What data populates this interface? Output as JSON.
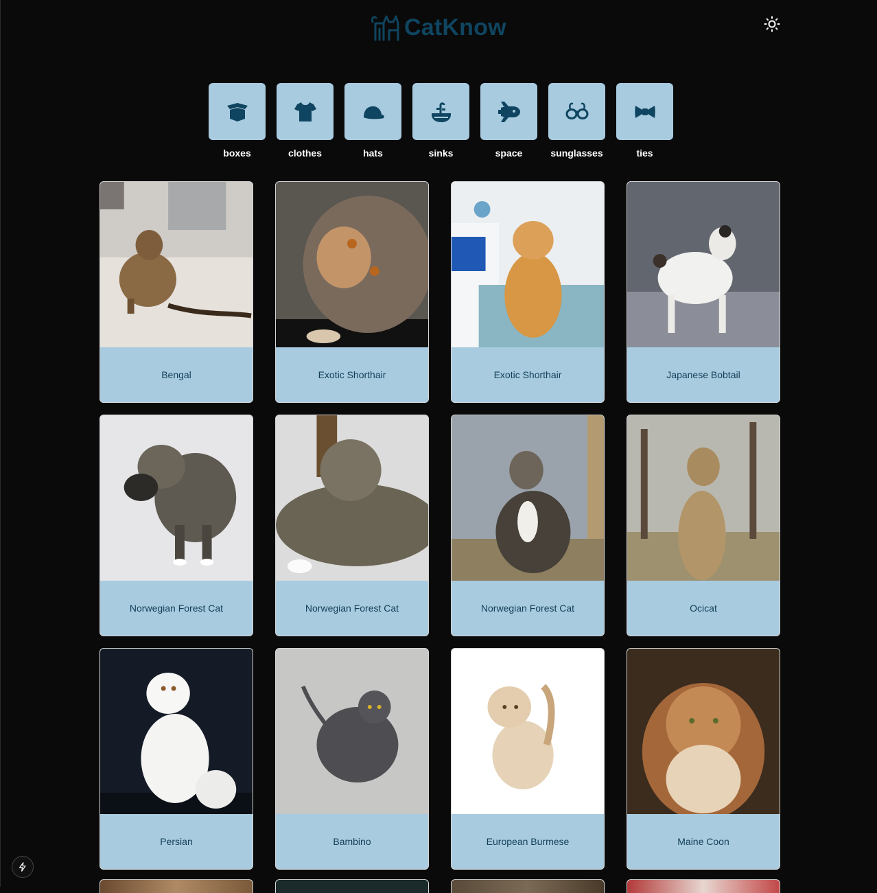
{
  "app": {
    "name": "CatKnow"
  },
  "header": {
    "logo_icon": "cat-icon",
    "theme_toggle_icon": "sun-icon"
  },
  "categories": [
    {
      "label": "boxes",
      "icon": "box-icon"
    },
    {
      "label": "clothes",
      "icon": "shirt-icon"
    },
    {
      "label": "hats",
      "icon": "hat-icon"
    },
    {
      "label": "sinks",
      "icon": "sink-icon"
    },
    {
      "label": "space",
      "icon": "shuttle-icon"
    },
    {
      "label": "sunglasses",
      "icon": "glasses-icon"
    },
    {
      "label": "ties",
      "icon": "bowtie-icon"
    }
  ],
  "cards": [
    {
      "name": "Bengal"
    },
    {
      "name": "Exotic Shorthair"
    },
    {
      "name": "Exotic Shorthair"
    },
    {
      "name": "Japanese Bobtail"
    },
    {
      "name": "Norwegian Forest Cat"
    },
    {
      "name": "Norwegian Forest Cat"
    },
    {
      "name": "Norwegian Forest Cat"
    },
    {
      "name": "Ocicat"
    },
    {
      "name": "Persian"
    },
    {
      "name": "Bambino"
    },
    {
      "name": "European Burmese"
    },
    {
      "name": "Maine Coon"
    }
  ],
  "colors": {
    "background": "#0a0a0a",
    "tile": "#a8cbe0",
    "accent": "#0f4560",
    "card_text": "#123f57"
  }
}
